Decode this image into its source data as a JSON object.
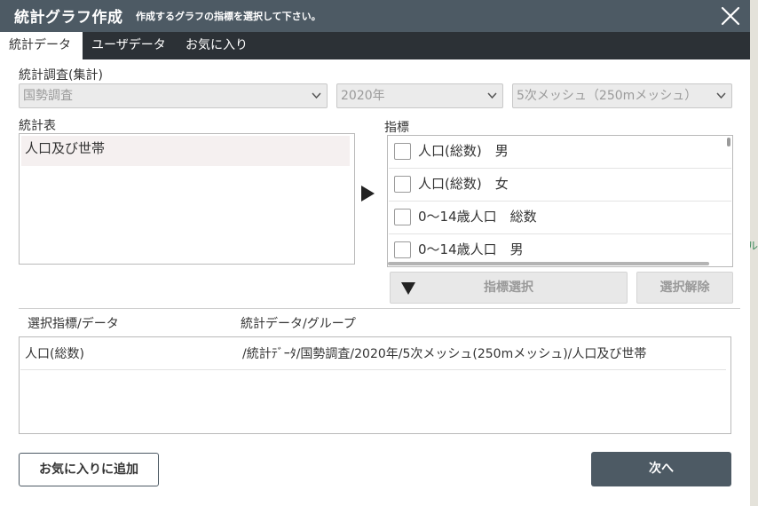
{
  "dialog": {
    "title": "統計グラフ作成",
    "subtitle": "作成するグラフの指標を選択して下さい。"
  },
  "tabs": [
    {
      "label": "統計データ",
      "active": true
    },
    {
      "label": "ユーザデータ",
      "active": false
    },
    {
      "label": "お気に入り",
      "active": false
    }
  ],
  "survey": {
    "label": "統計調査(集計)",
    "survey_value": "国勢調査",
    "year_value": "2020年",
    "mesh_value": "5次メッシュ（250mメッシュ）"
  },
  "stat_table": {
    "label": "統計表",
    "items": [
      "人口及び世帯"
    ]
  },
  "indicators": {
    "label": "指標",
    "items": [
      {
        "label": "人口(総数)　男",
        "checked": false
      },
      {
        "label": "人口(総数)　女",
        "checked": false
      },
      {
        "label": "0～14歳人口　総数",
        "checked": false
      },
      {
        "label": "0～14歳人口　男",
        "checked": false
      }
    ]
  },
  "actions": {
    "select_indicator": "指標選択",
    "deselect": "選択解除"
  },
  "selection": {
    "col_indicator": "選択指標/データ",
    "col_group": "統計データ/グループ",
    "rows": [
      {
        "indicator": "人口(総数)",
        "group": "/統計ﾃﾞｰﾀ/国勢調査/2020年/5次メッシュ(250mメッシュ)/人口及び世帯"
      }
    ]
  },
  "footer": {
    "add_favorite": "お気に入りに追加",
    "next": "次へ"
  },
  "colors": {
    "titlebar": "#4d5a64",
    "tabbar": "#2c3136",
    "primary_button": "#4d5a64"
  }
}
